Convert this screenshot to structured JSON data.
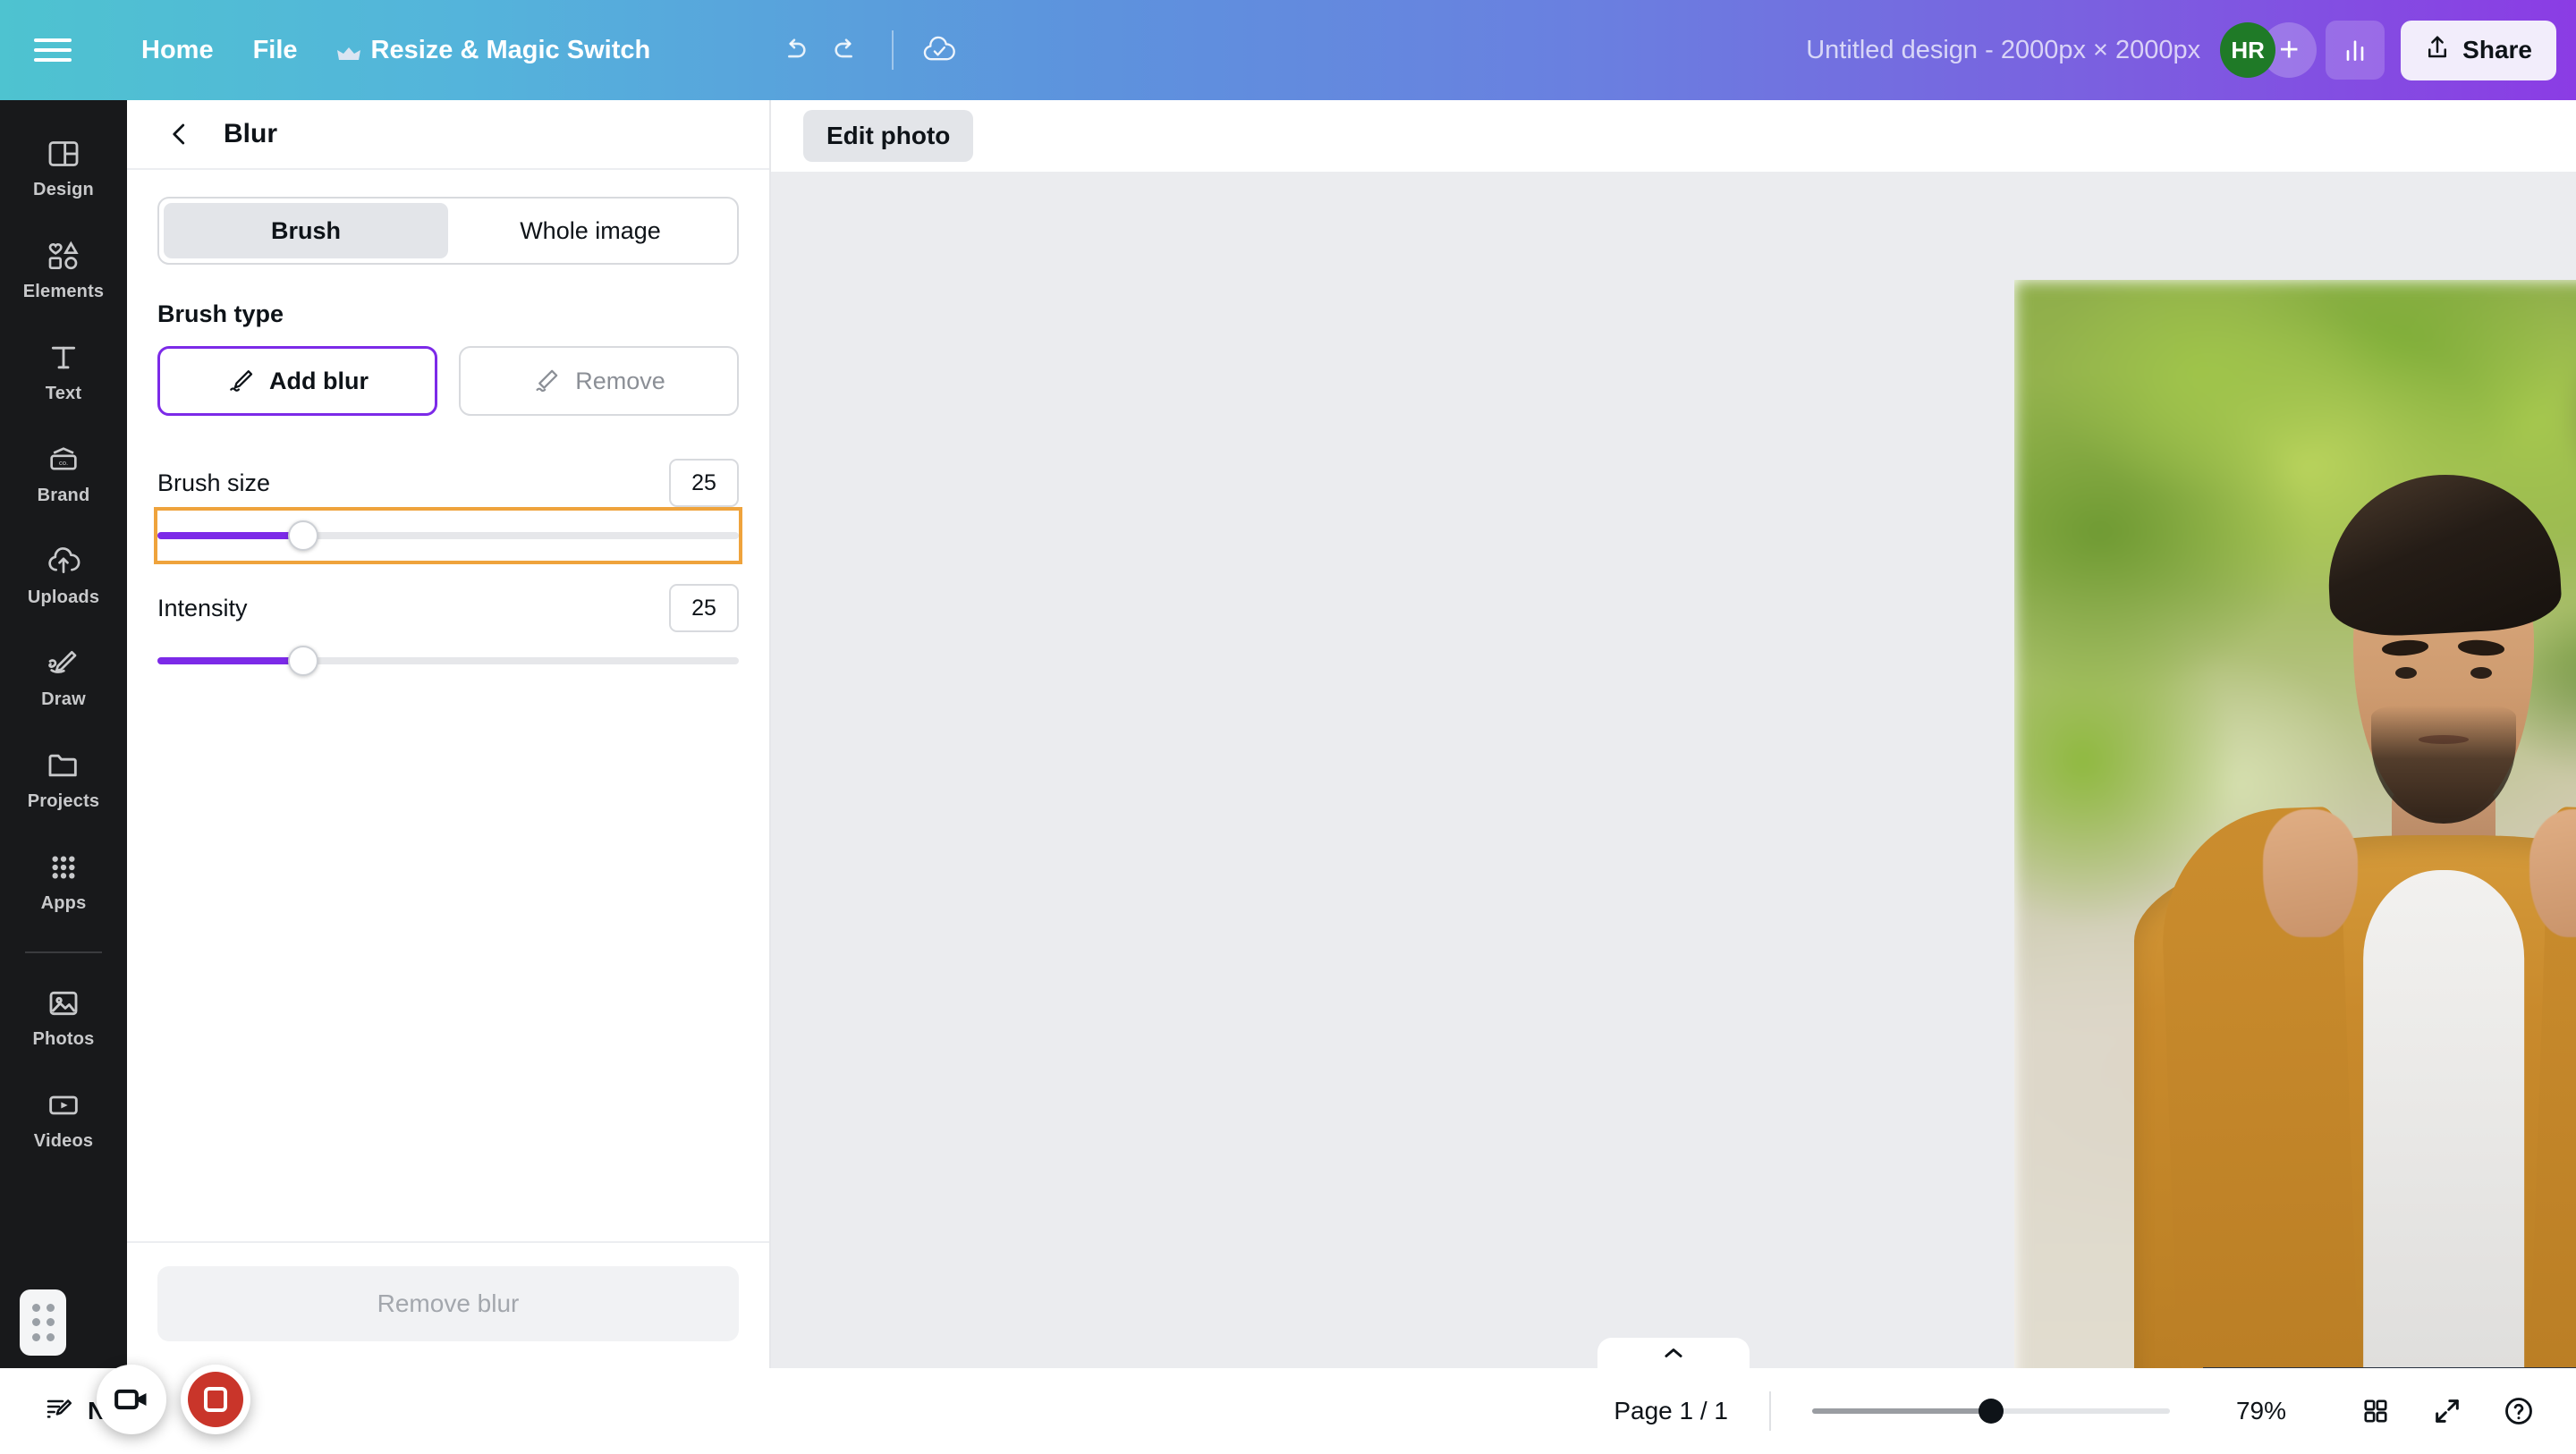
{
  "topbar": {
    "menu_icon": "hamburger-icon",
    "nav": [
      {
        "label": "Home",
        "icon": ""
      },
      {
        "label": "File",
        "icon": ""
      },
      {
        "label": "Resize & Magic Switch",
        "icon": "crown-icon"
      }
    ],
    "undo_icon": "undo-icon",
    "redo_icon": "redo-icon",
    "saved_icon": "cloud-check-icon",
    "doc_title": "Untitled design - 2000px × 2000px",
    "avatar_initials": "HR",
    "avatar_color": "#1f7a27",
    "add_collaborator_label": "+",
    "insights_icon": "bar-chart-icon",
    "share_label": "Share",
    "share_icon": "share-upload-icon"
  },
  "rail": {
    "items": [
      {
        "label": "Design",
        "icon": "layout-icon"
      },
      {
        "label": "Elements",
        "icon": "shapes-icon"
      },
      {
        "label": "Text",
        "icon": "text-t-icon"
      },
      {
        "label": "Brand",
        "icon": "brand-card-icon"
      },
      {
        "label": "Uploads",
        "icon": "cloud-upload-icon"
      },
      {
        "label": "Draw",
        "icon": "pen-draw-icon"
      },
      {
        "label": "Projects",
        "icon": "folder-icon"
      },
      {
        "label": "Apps",
        "icon": "grid-apps-icon"
      }
    ],
    "items_below": [
      {
        "label": "Photos",
        "icon": "image-icon"
      },
      {
        "label": "Videos",
        "icon": "video-play-icon"
      }
    ]
  },
  "panel": {
    "back_icon": "chevron-left-icon",
    "title": "Blur",
    "tabs": [
      {
        "label": "Brush",
        "active": true
      },
      {
        "label": "Whole image",
        "active": false
      }
    ],
    "brush_type_label": "Brush type",
    "brush_types": [
      {
        "label": "Add blur",
        "icon": "pen-blur-icon",
        "selected": true
      },
      {
        "label": "Remove",
        "icon": "eraser-icon",
        "selected": false
      }
    ],
    "sliders": [
      {
        "label": "Brush size",
        "value": "25",
        "percent": 25,
        "focused": true
      },
      {
        "label": "Intensity",
        "value": "25",
        "percent": 25,
        "focused": false
      }
    ],
    "footer_button": "Remove blur"
  },
  "context_bar": {
    "edit_photo_label": "Edit photo"
  },
  "canvas": {
    "collapse_icon": "chevron-up-icon",
    "photo_alt": "portrait-photo"
  },
  "bottombar": {
    "notes_label": "Notes",
    "notes_icon": "notes-pencil-icon",
    "page_label": "Page 1 / 1",
    "zoom_value": "79%",
    "zoom_percent": 50,
    "grid_icon": "grid-view-icon",
    "fullscreen_icon": "expand-arrows-icon",
    "help_icon": "question-circle-icon"
  },
  "recorder": {
    "camera_icon": "video-camera-icon",
    "stop_icon": "stop-record-icon",
    "apps_icon": "app-dots-icon",
    "stop_color": "#c9352a"
  },
  "colors": {
    "brand_purple": "#7c2ae8",
    "focus_orange": "#efa33c",
    "rail_bg": "#18191b",
    "stage_bg": "#ebecef"
  }
}
